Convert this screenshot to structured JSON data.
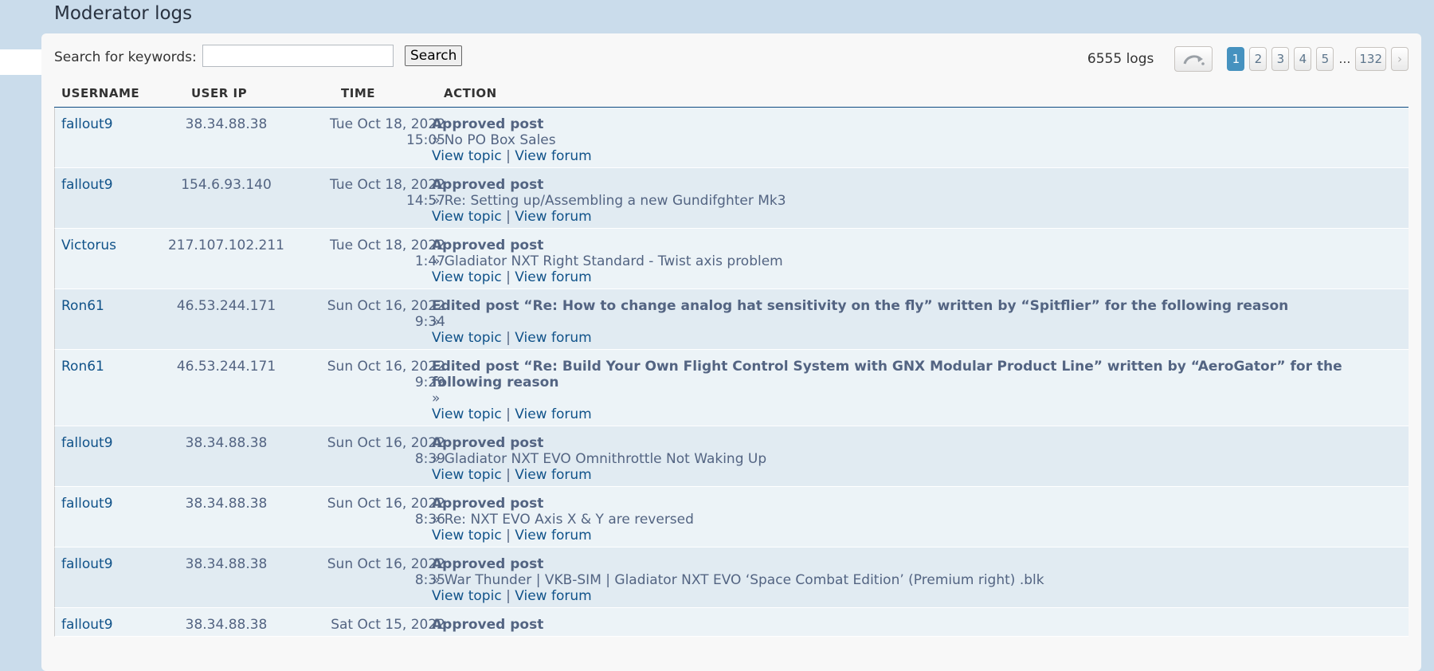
{
  "page_title": "Moderator logs",
  "search": {
    "label": "Search for keywords:",
    "value": "",
    "placeholder": "",
    "button_label": "Search"
  },
  "pagination": {
    "count_label": "6555 logs",
    "pages": [
      "1",
      "2",
      "3",
      "4",
      "5"
    ],
    "ellipsis": "…",
    "last_page": "132",
    "active_page": "1",
    "next_symbol": "›"
  },
  "columns": {
    "username": "USERNAME",
    "user_ip": "USER IP",
    "time": "TIME",
    "action": "ACTION"
  },
  "colors": {
    "green_user": "#119e1b",
    "purple_user": "#b147e0",
    "link": "#105289",
    "active_page": "#4692bf"
  },
  "links": {
    "view_topic": "View topic",
    "separator": "|",
    "view_forum": "View forum"
  },
  "rows": [
    {
      "username": "fallout9",
      "ip": "38.34.88.38",
      "date": "Tue Oct 18, 2022",
      "clock": "15:05",
      "action": "Approved post",
      "detail": "» No PO Box Sales"
    },
    {
      "username": "fallout9",
      "ip": "154.6.93.140",
      "date": "Tue Oct 18, 2022",
      "clock": "14:57",
      "action": "Approved post",
      "detail": "» Re: Setting up/Assembling a new Gundifghter Mk3"
    },
    {
      "username": "Victorus",
      "ip": "217.107.102.211",
      "date": "Tue Oct 18, 2022",
      "clock": "1:47",
      "action": "Approved post",
      "detail": "» Gladiator NXT Right Standard - Twist axis problem"
    },
    {
      "username": "Ron61",
      "ip": "46.53.244.171",
      "date": "Sun Oct 16, 2022",
      "clock": "9:34",
      "action": "Edited post “Re: How to change analog hat sensitivity on the fly” written by “Spitflier” for the following reason",
      "detail": "»"
    },
    {
      "username": "Ron61",
      "ip": "46.53.244.171",
      "date": "Sun Oct 16, 2022",
      "clock": "9:29",
      "action": "Edited post “Re: Build Your Own Flight Control System with GNX Modular Product Line” written by “AeroGator” for the following reason",
      "detail": "»"
    },
    {
      "username": "fallout9",
      "ip": "38.34.88.38",
      "date": "Sun Oct 16, 2022",
      "clock": "8:39",
      "action": "Approved post",
      "detail": "» Gladiator NXT EVO Omnithrottle Not Waking Up"
    },
    {
      "username": "fallout9",
      "ip": "38.34.88.38",
      "date": "Sun Oct 16, 2022",
      "clock": "8:36",
      "action": "Approved post",
      "detail": "» Re: NXT EVO Axis X & Y are reversed"
    },
    {
      "username": "fallout9",
      "ip": "38.34.88.38",
      "date": "Sun Oct 16, 2022",
      "clock": "8:35",
      "action": "Approved post",
      "detail": "» War Thunder | VKB-SIM | Gladiator NXT EVO ‘Space Combat Edition’ (Premium right) .blk"
    },
    {
      "username": "fallout9",
      "ip": "38.34.88.38",
      "date": "Sat Oct 15, 2022",
      "clock": "",
      "action": "Approved post",
      "detail": ""
    }
  ]
}
